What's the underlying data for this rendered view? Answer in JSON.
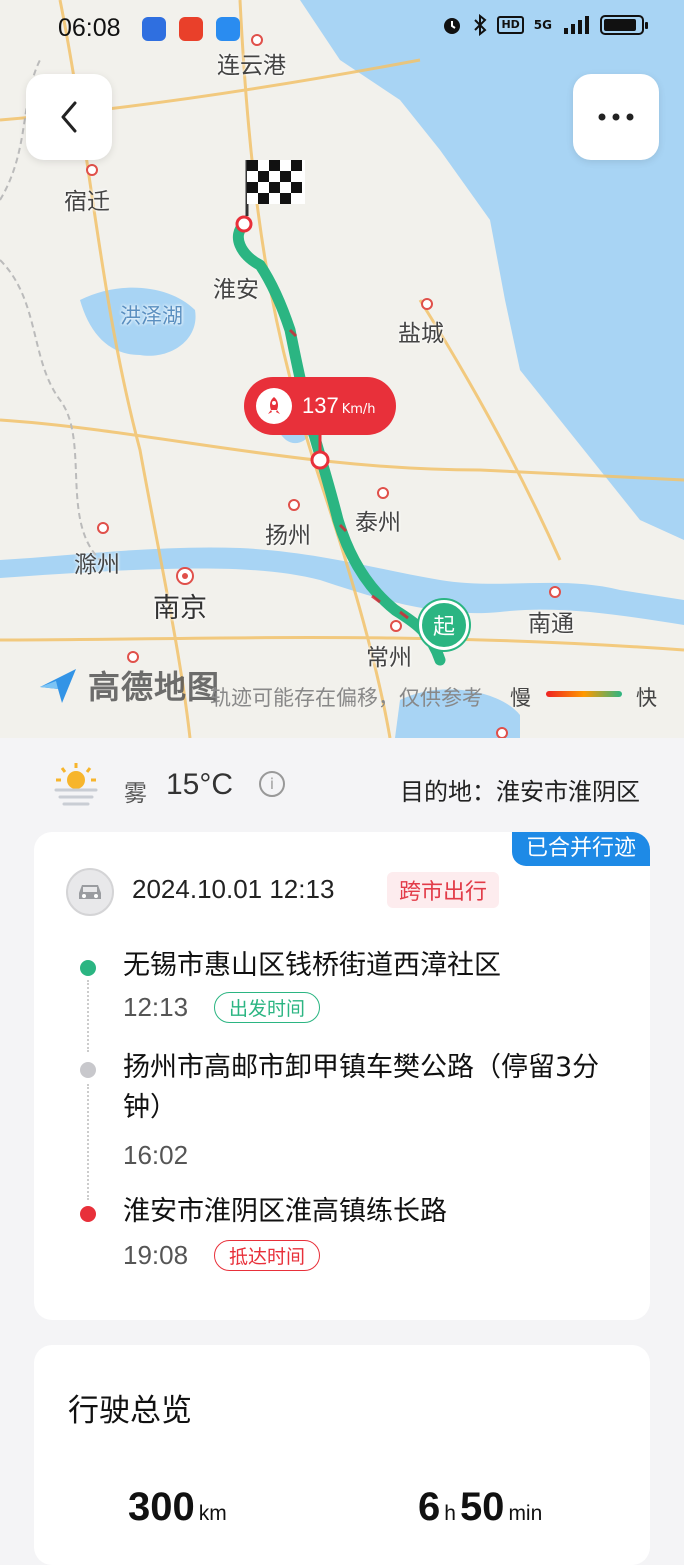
{
  "status": {
    "time": "06:08",
    "network": "5G",
    "hd": "HD",
    "battery_level": 0.9
  },
  "map": {
    "labels": {
      "lianyungang": "连云港",
      "suqian": "宿迁",
      "huaian": "淮安",
      "hongzehu": "洪泽湖",
      "yancheng": "盐城",
      "yangzhou": "扬州",
      "taizhou": "泰州",
      "chuzhou": "滁州",
      "nanjing": "南京",
      "changzhou": "常州",
      "nantong": "南通"
    },
    "speed_value": "137",
    "speed_unit": "Km/h",
    "start_label": "起",
    "logo_text": "高德地图",
    "disclaimer": "轨迹可能存在偏移，仅供参考",
    "legend_slow": "慢",
    "legend_fast": "快"
  },
  "weather": {
    "condition": "雾",
    "temperature": "15°C",
    "info_symbol": "i",
    "destination": "目的地：淮安市淮阴区"
  },
  "trip": {
    "merged_badge": "已合并行迹",
    "datetime": "2024.10.01 12:13",
    "type_tag": "跨市出行",
    "stops": [
      {
        "address": "无锡市惠山区钱桥街道西漳社区",
        "time": "12:13",
        "tag": "出发时间"
      },
      {
        "address": "扬州市高邮市卸甲镇车樊公路（停留3分钟）",
        "time": "16:02",
        "tag": ""
      },
      {
        "address": "淮安市淮阴区淮高镇练长路",
        "time": "19:08",
        "tag": "抵达时间"
      }
    ]
  },
  "overview": {
    "title": "行驶总览",
    "distance_value": "300",
    "distance_unit": "km",
    "hours_value": "6",
    "hours_unit": "h",
    "minutes_value": "50",
    "minutes_unit": "min"
  },
  "colors": {
    "route_green": "#2bb582",
    "alert_red": "#e8303a",
    "badge_blue": "#1e8ae6",
    "water": "#a8d4f4"
  }
}
